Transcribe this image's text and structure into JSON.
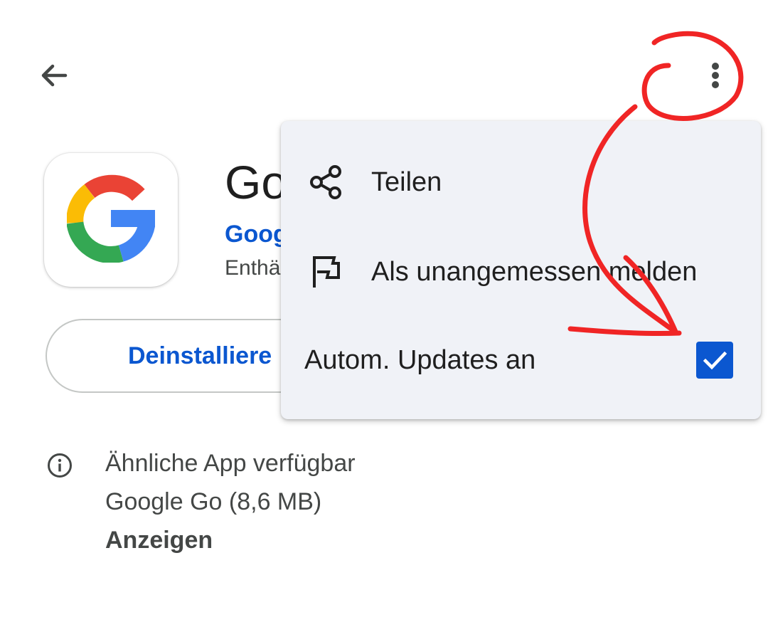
{
  "topbar": {
    "back_icon": "arrow-back-icon",
    "more_icon": "more-vert-icon"
  },
  "app": {
    "icon": "google-g-logo",
    "title": "Go",
    "developer": "Goog",
    "subtitle": "Enthä"
  },
  "actions": {
    "uninstall_label": "Deinstalliere"
  },
  "similar_app": {
    "icon": "info-icon",
    "title": "Ähnliche App verfügbar",
    "detail": "Google Go (8,6 MB)",
    "link": "Anzeigen"
  },
  "menu": {
    "share_label": "Teilen",
    "share_icon": "share-icon",
    "report_label": "Als unangemessen melden",
    "report_icon": "flag-icon",
    "autoupdate_label": "Autom. Updates an",
    "autoupdate_checked": true
  },
  "colors": {
    "accent": "#0b57d0",
    "menu_bg": "#f0f2f7",
    "annotation": "#f02525",
    "text": "#1f1f1f",
    "secondary_text": "#444746"
  }
}
